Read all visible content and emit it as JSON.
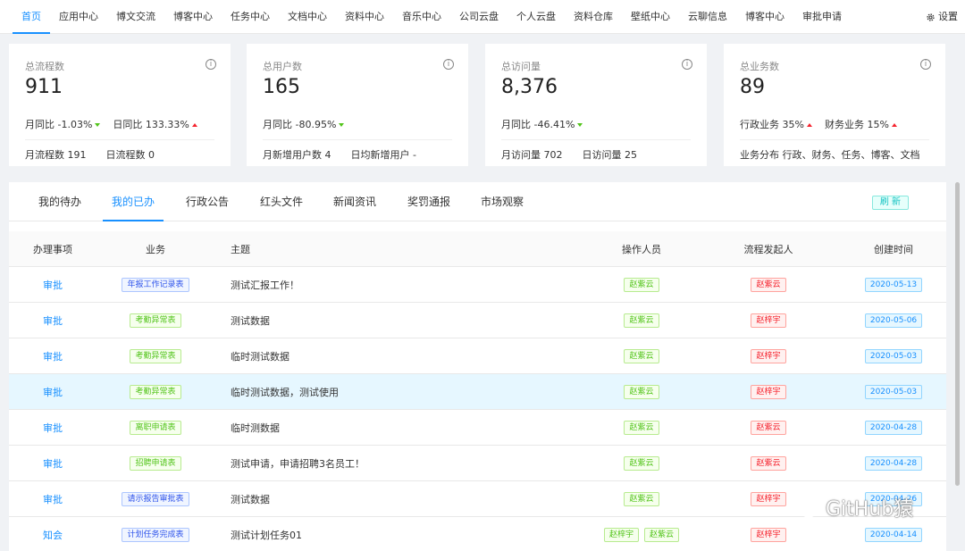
{
  "nav": {
    "items": [
      "首页",
      "应用中心",
      "博文交流",
      "博客中心",
      "任务中心",
      "文档中心",
      "资料中心",
      "音乐中心",
      "公司云盘",
      "个人云盘",
      "资料仓库",
      "壁纸中心",
      "云聊信息",
      "博客中心",
      "审批申请"
    ],
    "settings_label": "设置",
    "active_index": 0
  },
  "cards": [
    {
      "title": "总流程数",
      "value": "911",
      "trend": [
        {
          "label": "月同比",
          "value": "-1.03%",
          "dir": "down"
        },
        {
          "label": "日同比",
          "value": "133.33%",
          "dir": "up"
        }
      ],
      "foot": [
        {
          "label": "月流程数",
          "value": "191"
        },
        {
          "label": "日流程数",
          "value": "0"
        }
      ]
    },
    {
      "title": "总用户数",
      "value": "165",
      "trend": [
        {
          "label": "月同比",
          "value": "-80.95%",
          "dir": "down"
        }
      ],
      "foot": [
        {
          "label": "月新增用户数",
          "value": "4"
        },
        {
          "label": "日均新增用户",
          "value": "-"
        }
      ]
    },
    {
      "title": "总访问量",
      "value": "8,376",
      "trend": [
        {
          "label": "月同比",
          "value": "-46.41%",
          "dir": "down"
        }
      ],
      "foot": [
        {
          "label": "月访问量",
          "value": "702"
        },
        {
          "label": "日访问量",
          "value": "25"
        }
      ]
    },
    {
      "title": "总业务数",
      "value": "89",
      "trend": [
        {
          "label": "行政业务",
          "value": "35%",
          "dir": "up"
        },
        {
          "label": "财务业务",
          "value": "15%",
          "dir": "up"
        }
      ],
      "foot": [
        {
          "label": "业务分布",
          "value": "行政、财务、任务、博客、文档"
        }
      ]
    }
  ],
  "tabs": [
    "我的待办",
    "我的已办",
    "行政公告",
    "红头文件",
    "新闻资讯",
    "奖罚通报",
    "市场观察"
  ],
  "active_tab": 1,
  "refresh_label": "刷 新",
  "table": {
    "headers": [
      "办理事项",
      "业务",
      "主题",
      "操作人员",
      "流程发起人",
      "创建时间"
    ],
    "rows": [
      {
        "action": "审批",
        "biz": "年报工作记录表",
        "biz_color": "blue",
        "topic": "测试汇报工作！",
        "operators": [
          "赵紫云"
        ],
        "initiator": "赵紫云",
        "date": "2020-05-13"
      },
      {
        "action": "审批",
        "biz": "考勤异常表",
        "biz_color": "green",
        "topic": "测试数据",
        "operators": [
          "赵紫云"
        ],
        "initiator": "赵梓宇",
        "date": "2020-05-06"
      },
      {
        "action": "审批",
        "biz": "考勤异常表",
        "biz_color": "green",
        "topic": "临时测试数据",
        "operators": [
          "赵紫云"
        ],
        "initiator": "赵梓宇",
        "date": "2020-05-03"
      },
      {
        "action": "审批",
        "biz": "考勤异常表",
        "biz_color": "green",
        "topic": "临时测试数据，测试使用",
        "operators": [
          "赵紫云"
        ],
        "initiator": "赵梓宇",
        "date": "2020-05-03"
      },
      {
        "action": "审批",
        "biz": "离职申请表",
        "biz_color": "green",
        "topic": "临时测数据",
        "operators": [
          "赵紫云"
        ],
        "initiator": "赵紫云",
        "date": "2020-04-28"
      },
      {
        "action": "审批",
        "biz": "招聘申请表",
        "biz_color": "green",
        "topic": "测试申请，申请招聘3名员工！",
        "operators": [
          "赵紫云"
        ],
        "initiator": "赵紫云",
        "date": "2020-04-28"
      },
      {
        "action": "审批",
        "biz": "请示报告审批表",
        "biz_color": "blue",
        "topic": "测试数据",
        "operators": [
          "赵紫云"
        ],
        "initiator": "赵梓宇",
        "date": "2020-04-26"
      },
      {
        "action": "知会",
        "biz": "计划任务完成表",
        "biz_color": "blue",
        "topic": "测试计划任务01",
        "operators": [
          "赵梓宇",
          "赵紫云"
        ],
        "initiator": "赵梓宇",
        "date": "2020-04-14"
      }
    ],
    "highlight_row": 3
  },
  "watermark": "GitHub猿"
}
